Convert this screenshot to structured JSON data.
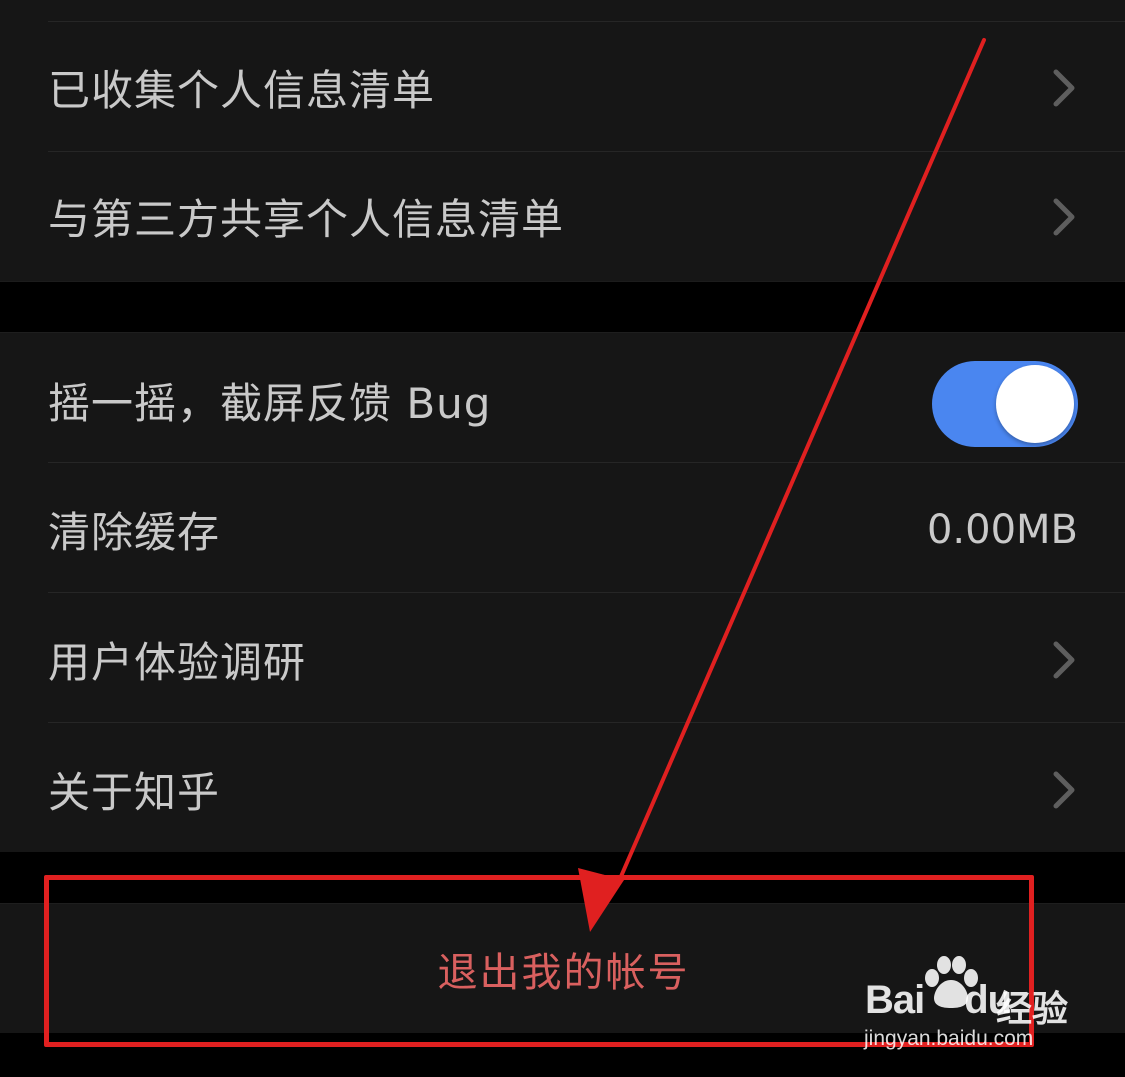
{
  "group1": {
    "items": [
      {
        "label": "已收集个人信息清单"
      },
      {
        "label": "与第三方共享个人信息清单"
      }
    ]
  },
  "group2": {
    "shake_feedback": {
      "label": "摇一摇，截屏反馈 Bug",
      "toggle_on": true
    },
    "clear_cache": {
      "label": "清除缓存",
      "value": "0.00MB"
    },
    "survey": {
      "label": "用户体验调研"
    },
    "about": {
      "label": "关于知乎"
    }
  },
  "logout": {
    "label": "退出我的帐号"
  },
  "watermark": {
    "brand_bai": "Bai",
    "brand_du": "du",
    "brand_jingyan": "经验",
    "url": "jingyan.baidu.com"
  },
  "colors": {
    "background": "#000000",
    "cell": "#161616",
    "text": "#c9c9c9",
    "toggle_on": "#4a86f0",
    "logout_text": "#d9605f",
    "annotation_red": "#e02020"
  },
  "icons": {
    "chevron": "chevron-right-icon",
    "annotation_arrow": "red-arrow",
    "paw": "baidu-paw-icon"
  }
}
